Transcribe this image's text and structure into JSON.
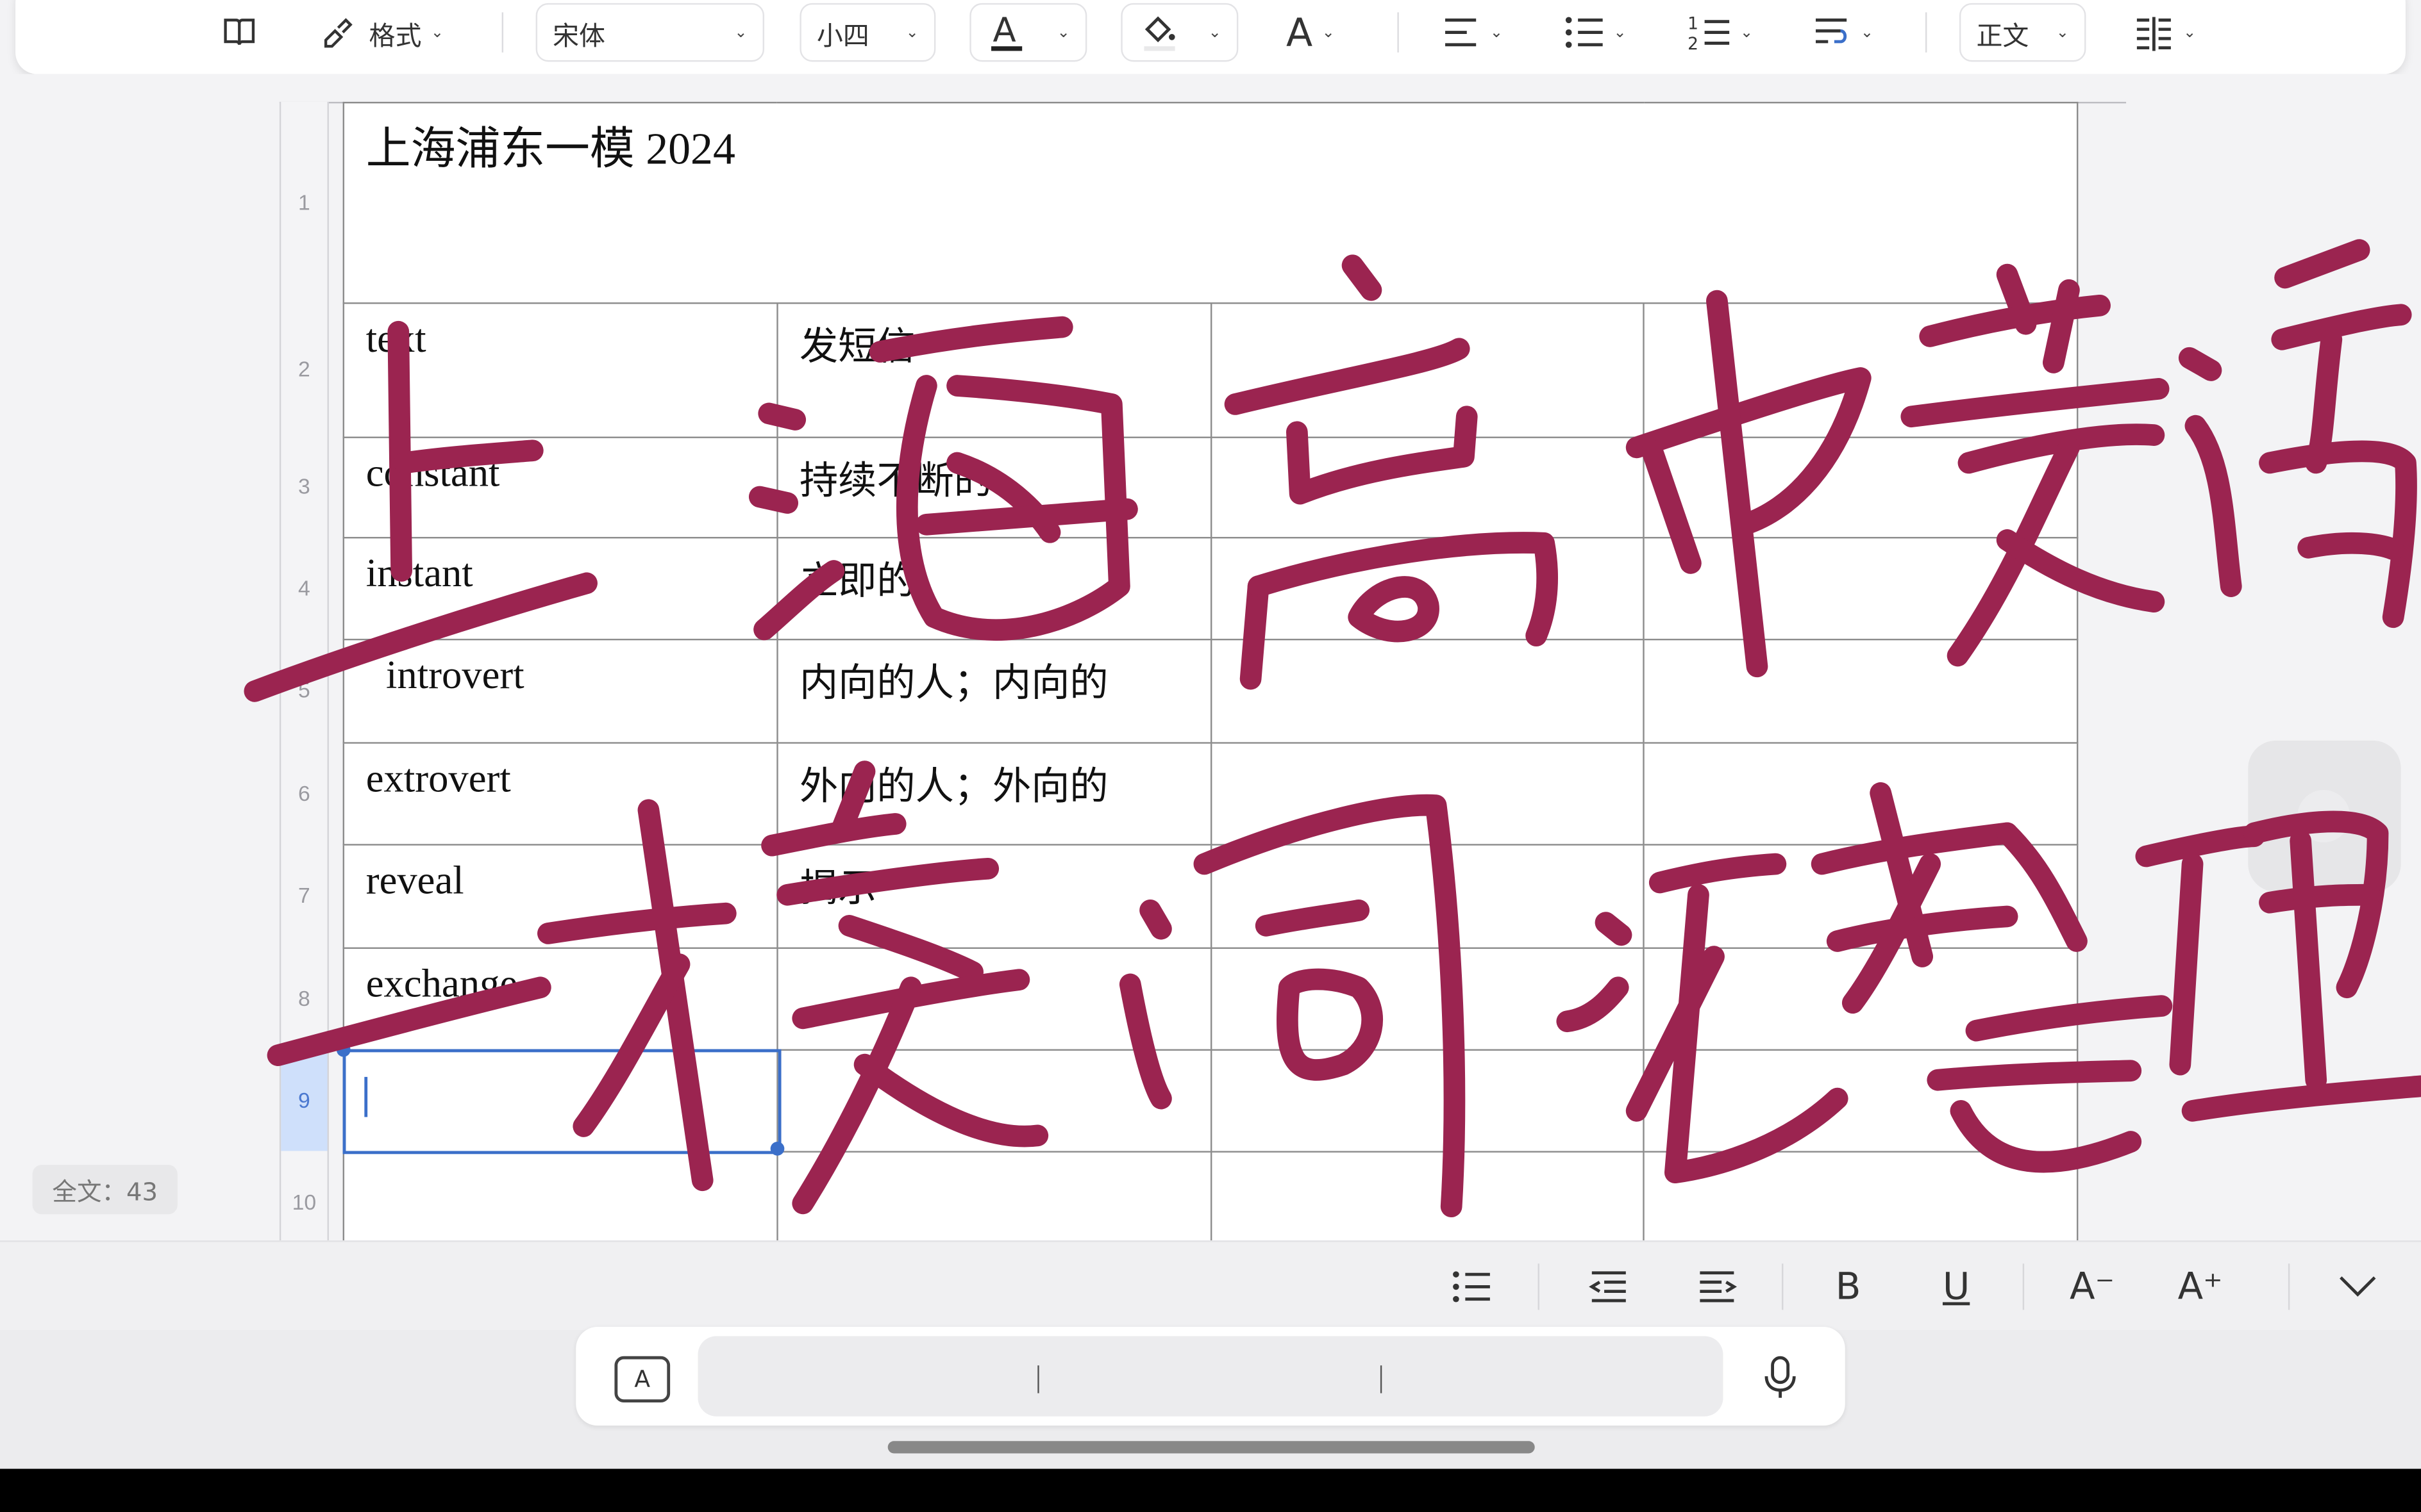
{
  "toolbar": {
    "style_label": "格式",
    "font_family": "宋体",
    "font_size": "小四",
    "paragraph_style": "正文",
    "icons": [
      "book-icon",
      "format-brush-icon",
      "font-color-icon",
      "highlight-fill-icon",
      "font-style-icon",
      "align-icon",
      "bullet-list-icon",
      "numbered-list-icon",
      "text-wrap-icon",
      "column-icon"
    ]
  },
  "document": {
    "title_cell": "上海浦东一模 2024",
    "rows": [
      {
        "num": "2",
        "en": "text",
        "zh": "发短信"
      },
      {
        "num": "3",
        "en": "constant",
        "zh": "持续不断的"
      },
      {
        "num": "4",
        "en": "instant",
        "zh": "立即的"
      },
      {
        "num": "5",
        "en": "  introvert",
        "zh": "内向的人；内向的"
      },
      {
        "num": "6",
        "en": "extrovert",
        "zh": "外向的人；外向的"
      },
      {
        "num": "7",
        "en": "reveal",
        "zh": "揭示"
      },
      {
        "num": "8",
        "en": "exchange",
        "zh": ""
      },
      {
        "num": "9",
        "en": "",
        "zh": ""
      },
      {
        "num": "10",
        "en": "",
        "zh": ""
      }
    ],
    "first_row_num": "1",
    "active_row": "9",
    "word_count": "全文：43"
  },
  "ink": {
    "line1": "上海高中英语",
    "line2": "一模词汇整理",
    "color": "#9b2450"
  },
  "bottom_bar": {
    "bold": "B",
    "underline": "U",
    "shrink": "A⁻",
    "enlarge": "A⁺"
  },
  "colors": {
    "accent": "#3b6fc9",
    "ink": "#9b2450"
  }
}
